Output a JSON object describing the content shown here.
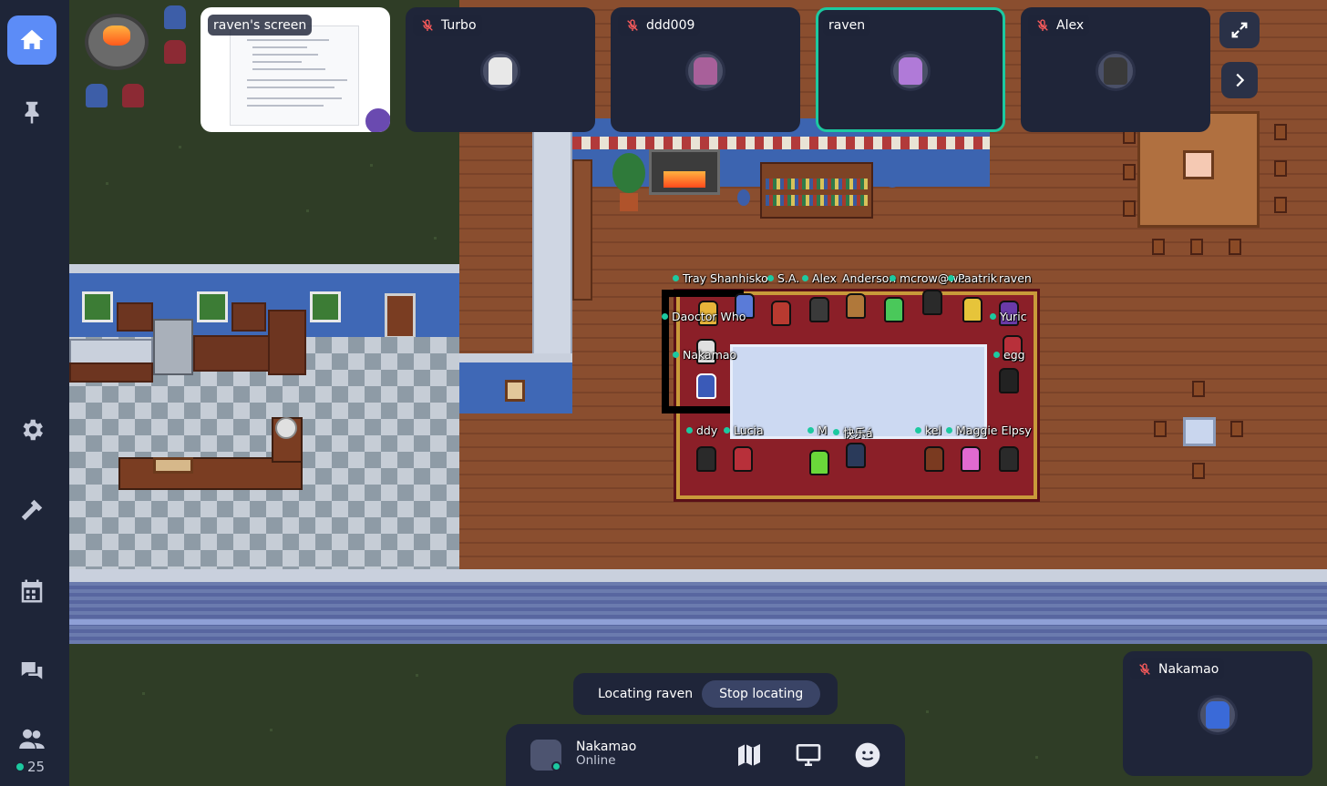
{
  "sidebar": {
    "people_count": "25",
    "items": [
      {
        "name": "home",
        "active": true
      },
      {
        "name": "pin"
      },
      {
        "name": "settings"
      },
      {
        "name": "build"
      },
      {
        "name": "calendar"
      },
      {
        "name": "chat"
      },
      {
        "name": "participants"
      }
    ]
  },
  "screen_share": {
    "label": "raven's screen"
  },
  "video_tiles": [
    {
      "name": "Turbo",
      "muted": true
    },
    {
      "name": "ddd009",
      "muted": true
    },
    {
      "name": "raven",
      "muted": false,
      "active": true
    },
    {
      "name": "Alex",
      "muted": true
    }
  ],
  "self_tile": {
    "name": "Nakamao",
    "muted": true
  },
  "map_labels": {
    "row1": [
      "Tray Shanhisko",
      "S.A.",
      "Alex",
      "Anderson",
      "mcrow@wc",
      "Paatrik",
      "raven"
    ],
    "left": [
      "Daoctor Who",
      "Nakamao"
    ],
    "right": [
      "Yuric",
      "egg"
    ],
    "row2": [
      "ddy",
      "Lucia",
      "M",
      "快乐á",
      "kel",
      "Maggie Elpsy"
    ]
  },
  "locate": {
    "text": "Locating raven",
    "button": "Stop locating"
  },
  "me": {
    "name": "Nakamao",
    "status": "Online"
  },
  "colors": {
    "accent": "#5c8cf7",
    "online": "#1cc9a0",
    "panel": "#1f2539"
  }
}
